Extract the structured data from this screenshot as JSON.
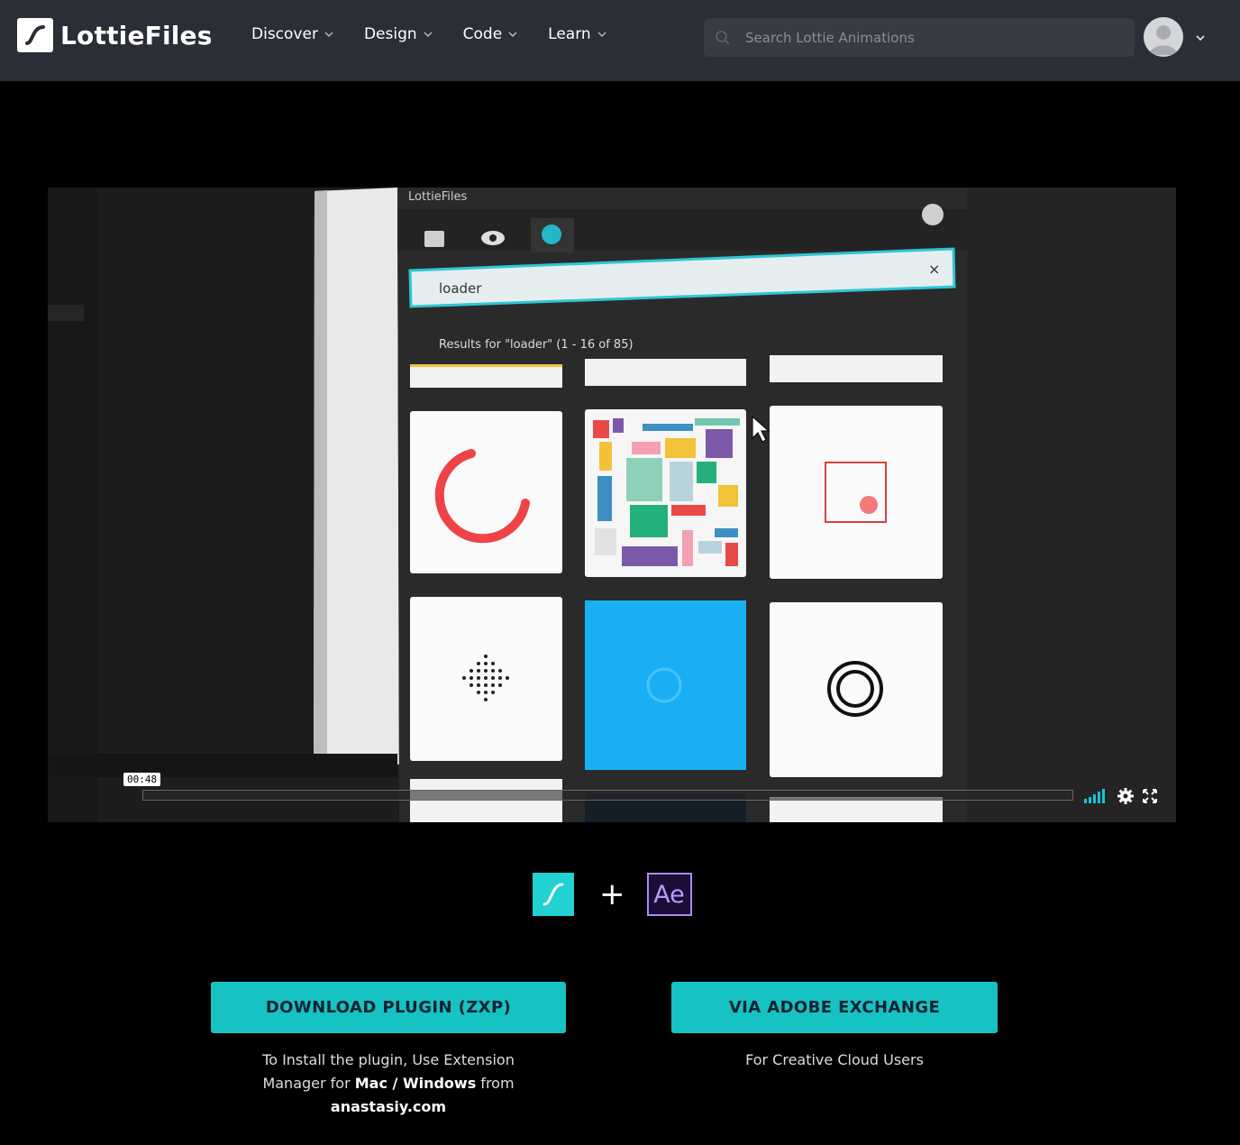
{
  "brand": {
    "name": "LottieFiles"
  },
  "nav": {
    "items": [
      {
        "label": "Discover"
      },
      {
        "label": "Design"
      },
      {
        "label": "Code"
      },
      {
        "label": "Learn"
      }
    ]
  },
  "search": {
    "placeholder": "Search Lottie Animations"
  },
  "video": {
    "panel_title": "LottieFiles",
    "search_value": "loader",
    "results_text": "Results for \"loader\" (1 - 16 of 85)",
    "time": "00:48",
    "progress": 0.0
  },
  "integration": {
    "plus": "+",
    "ae_label": "Ae"
  },
  "actions": {
    "download": {
      "label": "DOWNLOAD PLUGIN (ZXP)",
      "note_line1": "To Install the plugin, Use Extension",
      "note_line2_pre": "Manager for ",
      "note_mac": "Mac",
      "note_sep": " / ",
      "note_windows": "Windows",
      "note_line2_post": " from",
      "note_link": "anastasiy.com"
    },
    "exchange": {
      "label": "VIA ADOBE EXCHANGE",
      "note": "For Creative Cloud Users"
    }
  },
  "colors": {
    "accent": "#17c2c2",
    "topbar": "#2b2e36",
    "lottie_teal": "#22d1d1"
  }
}
